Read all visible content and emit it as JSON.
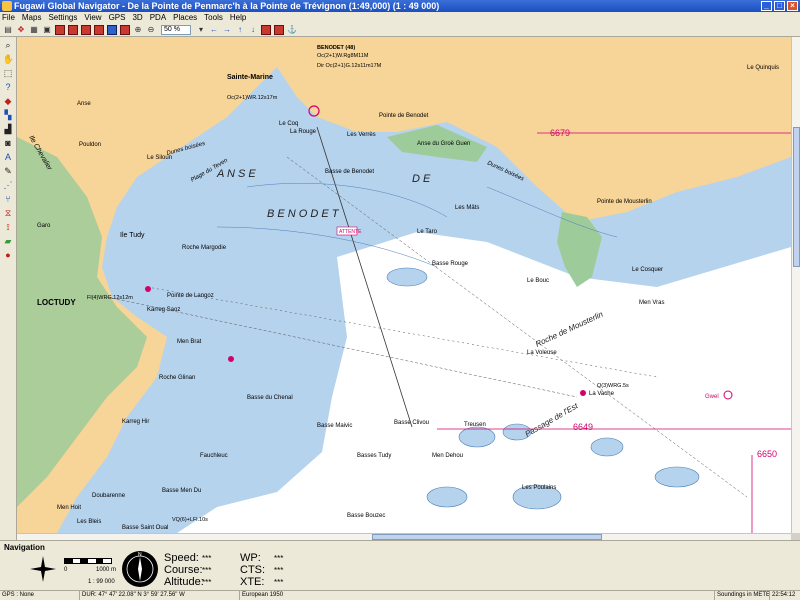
{
  "window": {
    "title": "Fugawi Global Navigator - De la Pointe de Penmarc'h à la Pointe de Trévignon (1:49,000)   (1 : 49 000)"
  },
  "menu": [
    "File",
    "Maps",
    "Settings",
    "View",
    "GPS",
    "3D",
    "PDA",
    "Places",
    "Tools",
    "Help"
  ],
  "toolbar": {
    "zoom_value": "50 %"
  },
  "chart": {
    "chart_numbers": [
      "6679",
      "6649",
      "6650"
    ],
    "places": {
      "sainte_marine": "Sainte-Marine",
      "loctudy": "LOCTUDY",
      "pointe_langoz": "Pointe de Langoz",
      "benodet": "BENODET",
      "anse": "A N S E",
      "de": "D E",
      "benodet_bay": "B E N O D E T",
      "pointe_mousterlin": "Pointe de Mousterlin",
      "roche_mousterlin": "Roche de Mousterlin",
      "passage_est": "Passage de l'Est",
      "ile_chevalier": "Ile Chevalier",
      "ile_tudy": "Ile Tudy",
      "dunes_bois": "Dunes boisées",
      "plage_teven": "Plage du Teven",
      "le_coq": "Le Coq",
      "les_verres": "Les Verrès",
      "la_rouge": "La Rouge",
      "basse_benodet": "Basse de Benodet",
      "les_mats": "Les Mâts",
      "le_taro": "Le Taro",
      "basse_rouge": "Basse Rouge",
      "basse_chenal": "Basse du Chenal",
      "roche_margodie": "Roche Margodie",
      "basse_maivic": "Basse Maivic",
      "basse_tudy": "Basses Tudy",
      "men_dehou": "Men Dehou",
      "les_poulains": "Les Poulains",
      "basse_clivou": "Basse Clivou",
      "treusen": "Treusen",
      "la_vache": "La Vache",
      "le_voleuse": "La Voleuse",
      "men_vras": "Men Vras",
      "le_bouc": "Le Bouc",
      "le_cosquer": "Le Cosquer",
      "le_quinquis": "Le Quinquis",
      "garo": "Garo",
      "anse_label": "Anse",
      "men_brat": "Men Brat",
      "roche_glinan": "Roche Glinan",
      "basse_men_du": "Basse Men Du",
      "men_hoit": "Men Hoit",
      "doubarenne": "Doubarenne",
      "fauchleuc": "Fauchleuc",
      "basse_saint_oual": "Basse Saint Oual",
      "les_bleis": "Les Bleis",
      "karreg_saoz": "Karreg Saoz",
      "karreg_hir": "Karreg Hir",
      "anse_gouel_guen": "Anse du Groë Guen",
      "pointe_benodet": "Pointe de Benodet",
      "le_siloun": "Le Siloun",
      "pouldon": "Pouldon",
      "gwel": "Gwel",
      "basse_bouzec": "Basse Bouzec"
    },
    "light_labels": {
      "benodet_48": "BENODET (48)",
      "oc_2_1": "Oc(2+1)W.Rg8M11M",
      "dir_oc": "Dir Oc(2+1)G.12s11m17M",
      "oc_wr": "Oc(2+1)WR.12s17m",
      "fl_wrg": "Fl(4)WRG.12s12m",
      "vq6": "VQ(6)+LFl.10s",
      "q_wrg": "Q(3)WRG.5s"
    },
    "anchor_label": "ATTENTE"
  },
  "navigation": {
    "title": "Navigation",
    "scale_zero": "0",
    "scale_end": "1000 m",
    "scale_ratio": "1 : 99 000",
    "speed_label": "Speed:",
    "speed_value": "***",
    "course_label": "Course:",
    "course_value": "***",
    "altitude_label": "Altitude:",
    "altitude_value": "***",
    "wp_label": "WP:",
    "wp_value": "***",
    "cts_label": "CTS:",
    "cts_value": "***",
    "xte_label": "XTE:",
    "xte_value": "***"
  },
  "status": {
    "gps": "GPS : None",
    "position": "DUR: 47° 47' 22.08\" N 3° 59' 27.56\" W",
    "datum": "European 1950",
    "soundings": "Soundings in METERS",
    "time": "22:54:12"
  },
  "colors": {
    "sea": "#b6d3ee",
    "deep_sea": "#ffffff",
    "land": "#f7d497",
    "drying": "#9ecb9a",
    "chart_red": "#d2006c"
  }
}
